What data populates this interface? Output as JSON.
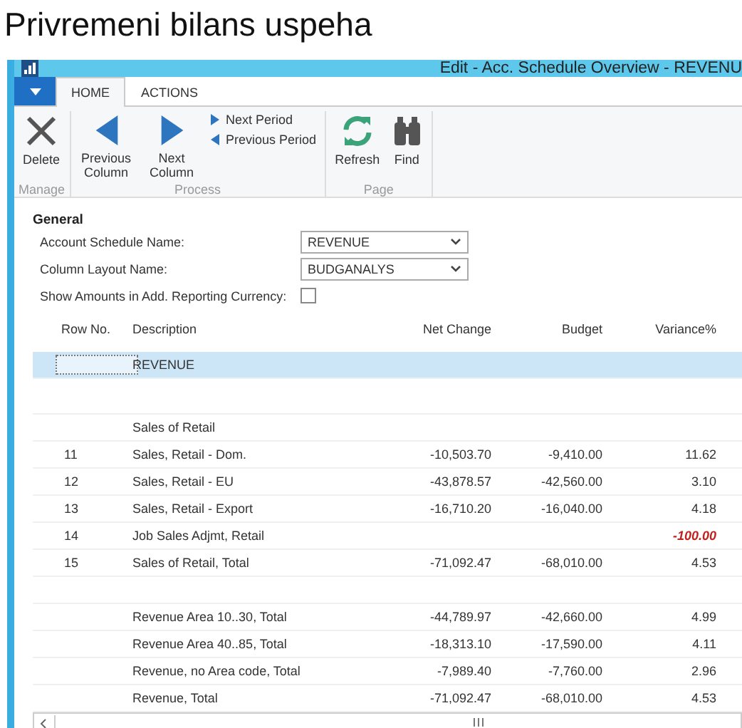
{
  "page_title": "Privremeni bilans uspeha",
  "window": {
    "title": "Edit - Acc. Schedule Overview - REVENU"
  },
  "tabs": [
    {
      "label": "HOME",
      "selected": true
    },
    {
      "label": "ACTIONS",
      "selected": false
    }
  ],
  "ribbon_groups": [
    {
      "label": "Manage",
      "buttons": [
        {
          "kind": "delete",
          "label": "Delete"
        }
      ]
    },
    {
      "label": "Process",
      "buttons": [
        {
          "kind": "previous",
          "label": "Previous Column"
        },
        {
          "kind": "next",
          "label": "Next Column"
        },
        {
          "kind": "small_stack",
          "items": [
            {
              "kind": "next",
              "label": "Next Period"
            },
            {
              "kind": "previous",
              "label": "Previous Period"
            }
          ]
        }
      ]
    },
    {
      "label": "Page",
      "buttons": [
        {
          "kind": "refresh",
          "label": "Refresh"
        },
        {
          "kind": "find",
          "label": "Find"
        }
      ]
    }
  ],
  "general": {
    "title": "General",
    "fields": [
      {
        "kind": "dropdown",
        "label": "Account Schedule Name:",
        "value": "REVENUE"
      },
      {
        "kind": "dropdown",
        "label": "Column Layout Name:",
        "value": "BUDGANALYS"
      },
      {
        "kind": "checkbox",
        "label": "Show Amounts in Add. Reporting Currency:",
        "checked": false
      }
    ]
  },
  "table": {
    "columns": [
      "Row No.",
      "Description",
      "Net Change",
      "Budget",
      "Variance%"
    ],
    "rows": [
      {
        "kind": "data",
        "description": "REVENUE",
        "selected": true
      },
      {
        "kind": "blank",
        "selected": false
      },
      {
        "kind": "data",
        "description": "Sales of Retail",
        "selected": false
      },
      {
        "kind": "data",
        "row_no": "11",
        "description": "Sales, Retail - Dom.",
        "net_change": "-10,503.70",
        "budget": "-9,410.00",
        "variance": "11.62",
        "selected": false,
        "flagged": false
      },
      {
        "kind": "data",
        "row_no": "12",
        "description": "Sales, Retail - EU",
        "net_change": "-43,878.57",
        "budget": "-42,560.00",
        "variance": "3.10",
        "selected": false,
        "flagged": false
      },
      {
        "kind": "data",
        "row_no": "13",
        "description": "Sales, Retail - Export",
        "net_change": "-16,710.20",
        "budget": "-16,040.00",
        "variance": "4.18",
        "selected": false,
        "flagged": false
      },
      {
        "kind": "data",
        "row_no": "14",
        "description": "Job Sales Adjmt, Retail",
        "variance": "-100.00",
        "selected": false,
        "flagged": true
      },
      {
        "kind": "data",
        "row_no": "15",
        "description": "Sales of Retail, Total",
        "net_change": "-71,092.47",
        "budget": "-68,010.00",
        "variance": "4.53",
        "selected": false,
        "flagged": false
      },
      {
        "kind": "blank",
        "selected": false
      },
      {
        "kind": "data",
        "description": "Revenue Area 10..30, Total",
        "net_change": "-44,789.97",
        "budget": "-42,660.00",
        "variance": "4.99",
        "selected": false,
        "flagged": false
      },
      {
        "kind": "data",
        "description": "Revenue Area 40..85, Total",
        "net_change": "-18,313.10",
        "budget": "-17,590.00",
        "variance": "4.11",
        "selected": false,
        "flagged": false
      },
      {
        "kind": "data",
        "description": "Revenue, no Area code, Total",
        "net_change": "-7,989.40",
        "budget": "-7,760.00",
        "variance": "2.96",
        "selected": false,
        "flagged": false
      },
      {
        "kind": "data",
        "description": "Revenue, Total",
        "net_change": "-71,092.47",
        "budget": "-68,010.00",
        "variance": "4.53",
        "selected": false,
        "flagged": false
      }
    ]
  }
}
